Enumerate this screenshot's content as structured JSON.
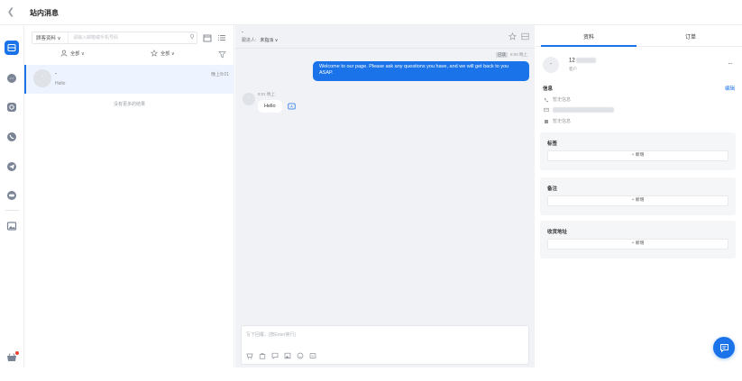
{
  "header": {
    "title": "站内消息"
  },
  "rail": {
    "items": [
      "inbox-icon",
      "messenger-icon",
      "instagram-icon",
      "whatsapp-icon",
      "telegram-icon",
      "line-icon",
      "gallery-icon"
    ]
  },
  "list": {
    "search_type": "顾客资料 ∨",
    "search_placeholder": "请输入邮箱或手机号码",
    "filter_left": "全部 ∨",
    "filter_right": "全部 ∨",
    "conversations": [
      {
        "avatar": "-",
        "name": "-",
        "time": "晚上8:01",
        "preview": "Hello"
      }
    ],
    "no_more": "没有更多的结果"
  },
  "chat": {
    "name": "-",
    "subtitle_label": "跟进人:",
    "subtitle_value": "未指派 ∨",
    "outgoing": {
      "read_badge": "已读",
      "time": "8:00 晚上",
      "text": "Welcome to our page. Please ask any questions you have, and we will get back to you ASAP."
    },
    "incoming": {
      "avatar": "-",
      "time": "8:01 晚上",
      "text": "Hello"
    },
    "composer_placeholder": "写下回覆，[按Enter换行]"
  },
  "info": {
    "tabs": [
      "资料",
      "订单"
    ],
    "profile": {
      "avatar": "-",
      "name_visible": "12",
      "role": "客户"
    },
    "info_title": "信息",
    "edit_label": "编辑",
    "phone": "暂无信息",
    "address": "暂无信息",
    "cards": [
      {
        "title": "标签",
        "add": "+ 新增"
      },
      {
        "title": "备注",
        "add": "+ 新增"
      },
      {
        "title": "收货地址",
        "add": "+ 新增"
      }
    ]
  },
  "colors": {
    "accent": "#1a73e8",
    "chat_bg": "#f0f2f5",
    "card_bg": "#f5f6f8"
  }
}
